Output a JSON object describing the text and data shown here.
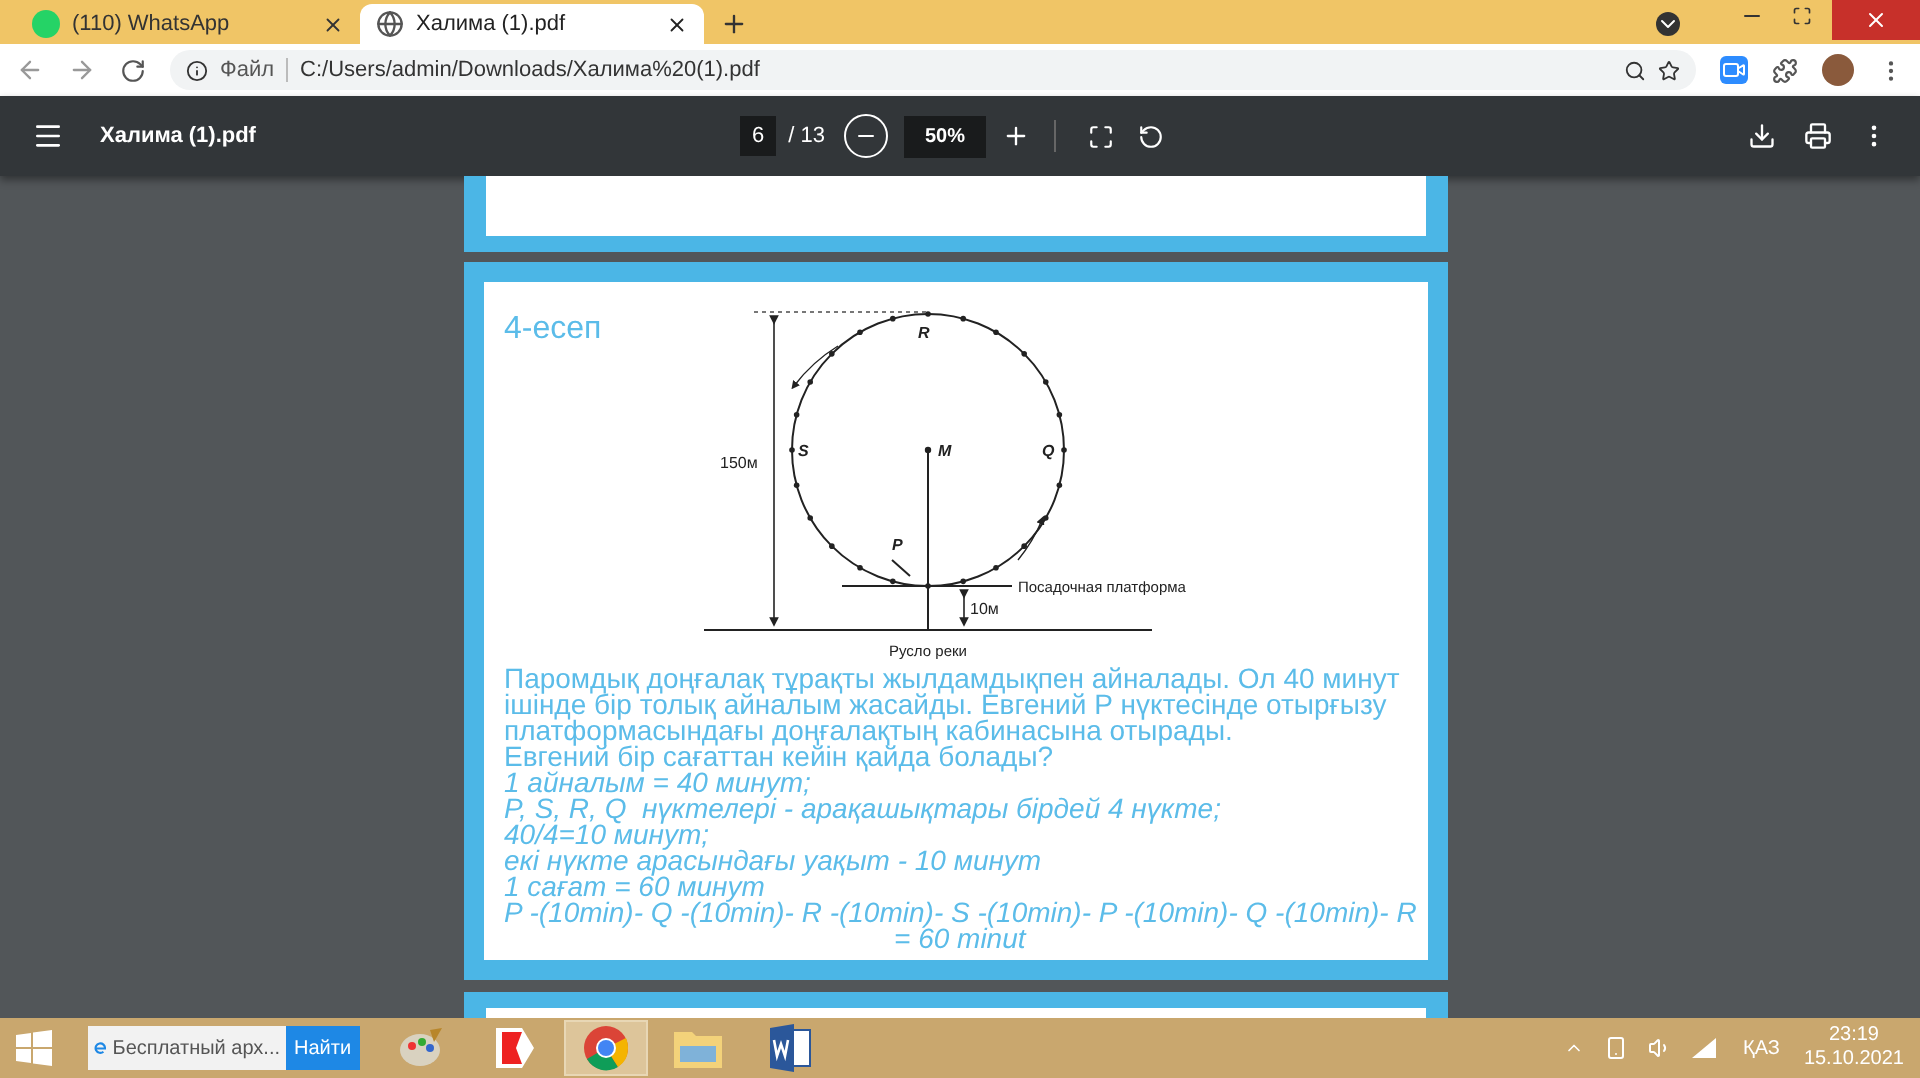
{
  "browser": {
    "tabs": [
      {
        "title": "(110) WhatsApp",
        "kind": "whatsapp",
        "selected": false
      },
      {
        "title": "Халима (1).pdf",
        "kind": "globe",
        "selected": true
      }
    ],
    "address": {
      "scheme": "Файл",
      "url": "C:/Users/admin/Downloads/Халима%20(1).pdf"
    }
  },
  "pdf_toolbar": {
    "title": "Халима (1).pdf",
    "page": "6",
    "total": "/ 13",
    "zoom": "50%"
  },
  "document": {
    "heading": "4-есеп",
    "figure": {
      "top_label": "R",
      "left_label": "S",
      "right_label": "Q",
      "center_label": "M",
      "bottom_label": "P",
      "height_label": "150м",
      "gap_label": "10м",
      "platform_label": "Посадочная платформа",
      "ground_label": "Русло реки"
    },
    "problem_lines": [
      "Паромдық доңғалақ тұрақты жылдамдықпен айналады. Ол 40 минут",
      "ішінде бір толық айналым жасайды. Евгений Р нүктесінде отырғызу",
      "платформасындағы доңғалақтың кабинасына отырады.",
      "Евгений бір сағаттан кейін қайда болады?"
    ],
    "solution_lines": [
      "1 айналым = 40 минут;",
      "P, S, R, Q  нүктелері - арақашықтары бірдей 4 нүкте;",
      "40/4=10 минут;",
      "екі нүкте арасындағы уақыт - 10 минут",
      "1 сағат = 60 минут",
      "P -(10min)- Q -(10min)- R -(10min)- S -(10min)- P -(10min)- Q -(10min)- R"
    ],
    "result": "= 60 minut"
  },
  "taskbar": {
    "search": {
      "value": "Бесплатный арх...",
      "button": "Найти"
    },
    "apps": [
      {
        "kind": "paint",
        "selected": false
      },
      {
        "kind": "yandex",
        "selected": false
      },
      {
        "kind": "chrome",
        "selected": true
      },
      {
        "kind": "explorer",
        "selected": false
      },
      {
        "kind": "word",
        "selected": false
      }
    ],
    "tray": {
      "language": "ҚАЗ",
      "time": "23:19",
      "date": "15.10.2021"
    }
  }
}
